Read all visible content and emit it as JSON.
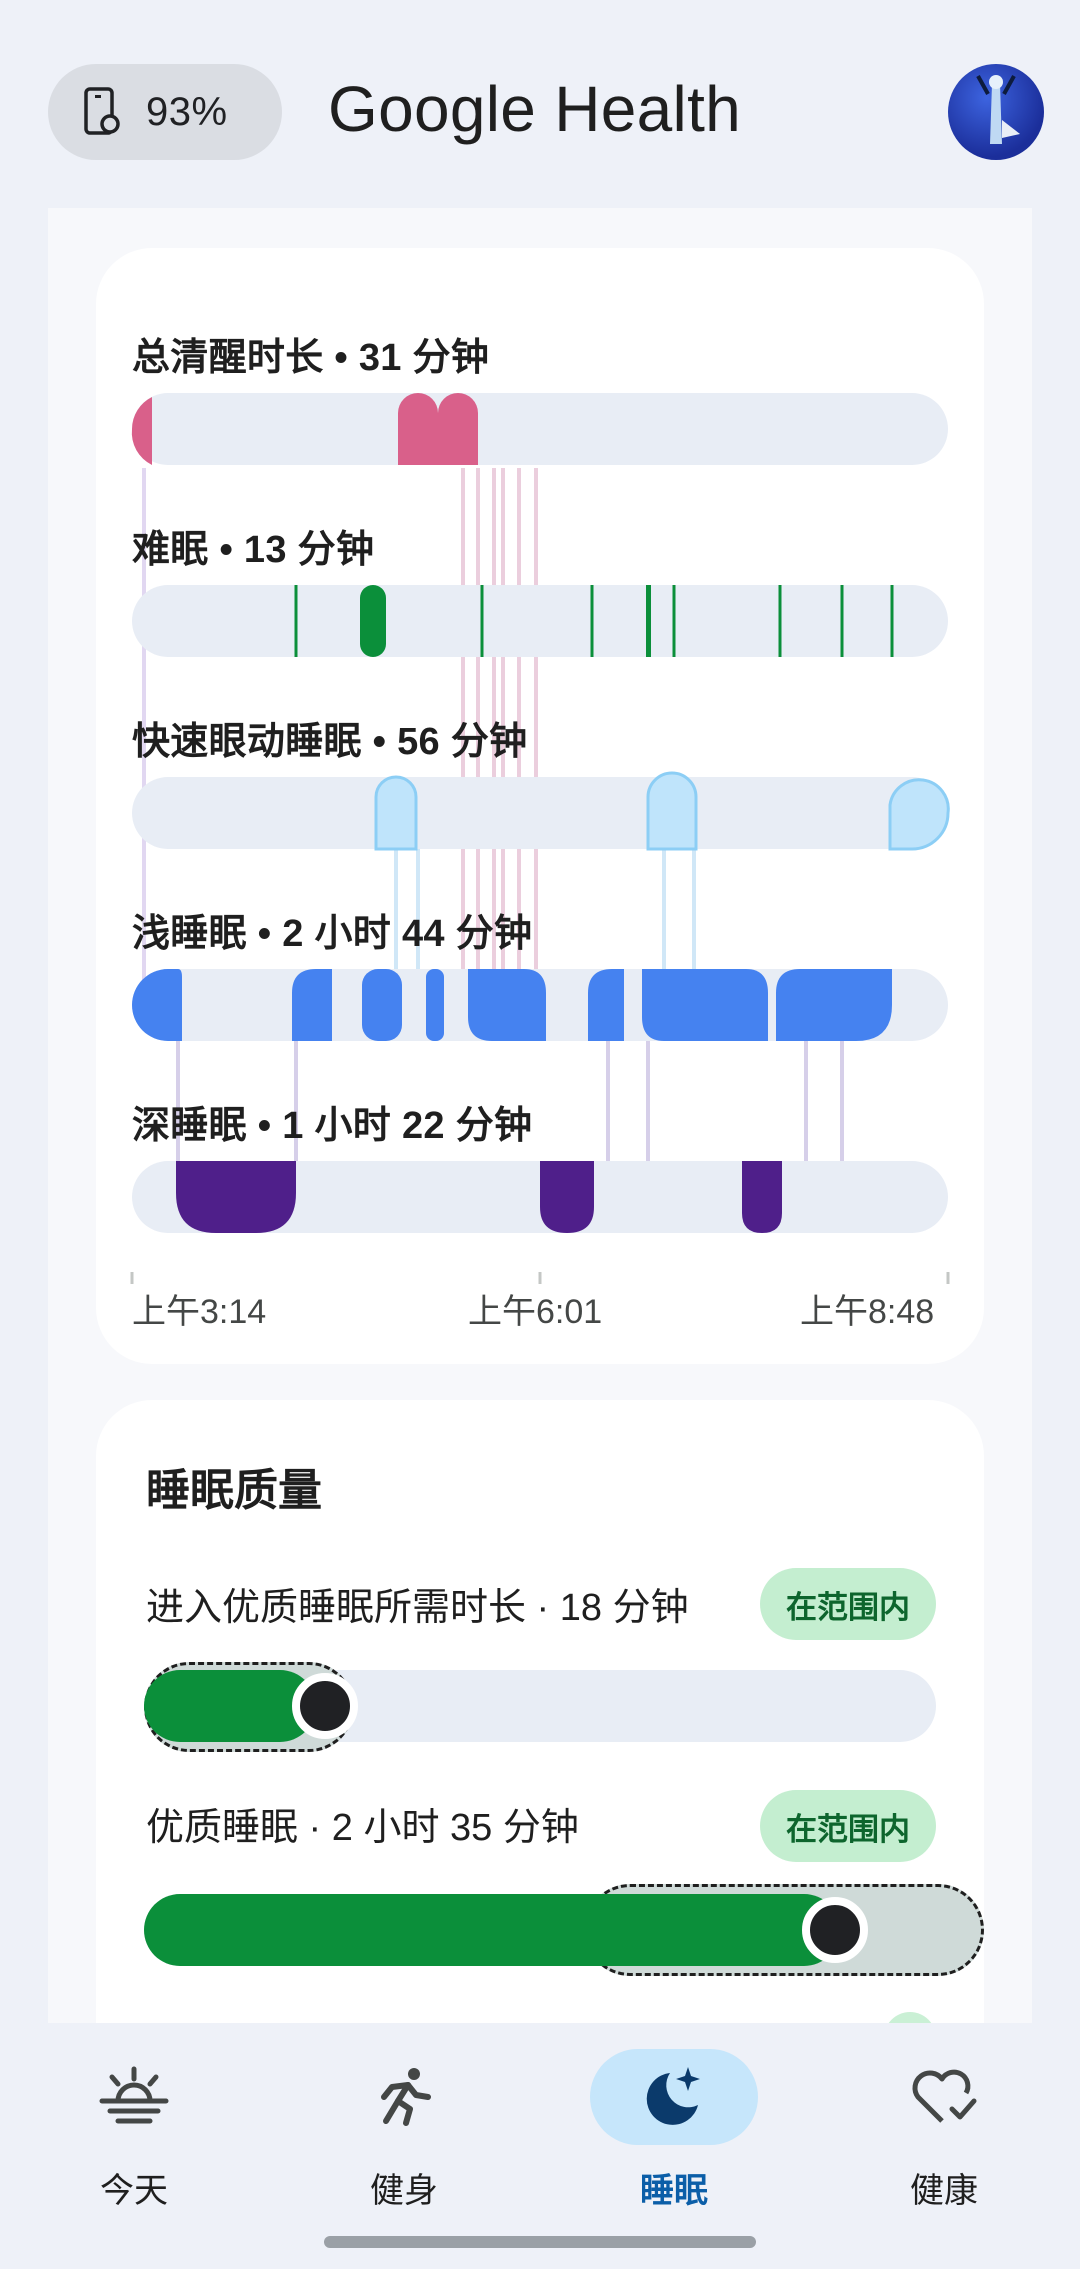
{
  "header": {
    "battery_percent": "93%",
    "app_title": "Google Health"
  },
  "stages": [
    {
      "label": "总清醒时长 • 31 分钟",
      "color": "#d9608a"
    },
    {
      "label": "难眠 • 13 分钟",
      "color": "#0b8f3a"
    },
    {
      "label": "快速眼动睡眠 • 56 分钟",
      "color": "#bfe4fb"
    },
    {
      "label": "浅睡眠 • 2 小时 44 分钟",
      "color": "#4582f0"
    },
    {
      "label": "深睡眠 • 1 小时 22 分钟",
      "color": "#4f1f8a"
    }
  ],
  "time_axis": [
    "上午3:14",
    "上午6:01",
    "上午8:48"
  ],
  "quality": {
    "title": "睡眠质量",
    "items": [
      {
        "label": "进入优质睡眠所需时长 · 18 分钟",
        "badge": "在范围内"
      },
      {
        "label": "优质睡眠 · 2 小时 35 分钟",
        "badge": "在范围内"
      }
    ]
  },
  "nav": [
    {
      "label": "今天",
      "icon": "sunrise-icon"
    },
    {
      "label": "健身",
      "icon": "running-icon"
    },
    {
      "label": "睡眠",
      "icon": "moon-star-icon",
      "active": true
    },
    {
      "label": "健康",
      "icon": "heart-check-icon"
    }
  ]
}
